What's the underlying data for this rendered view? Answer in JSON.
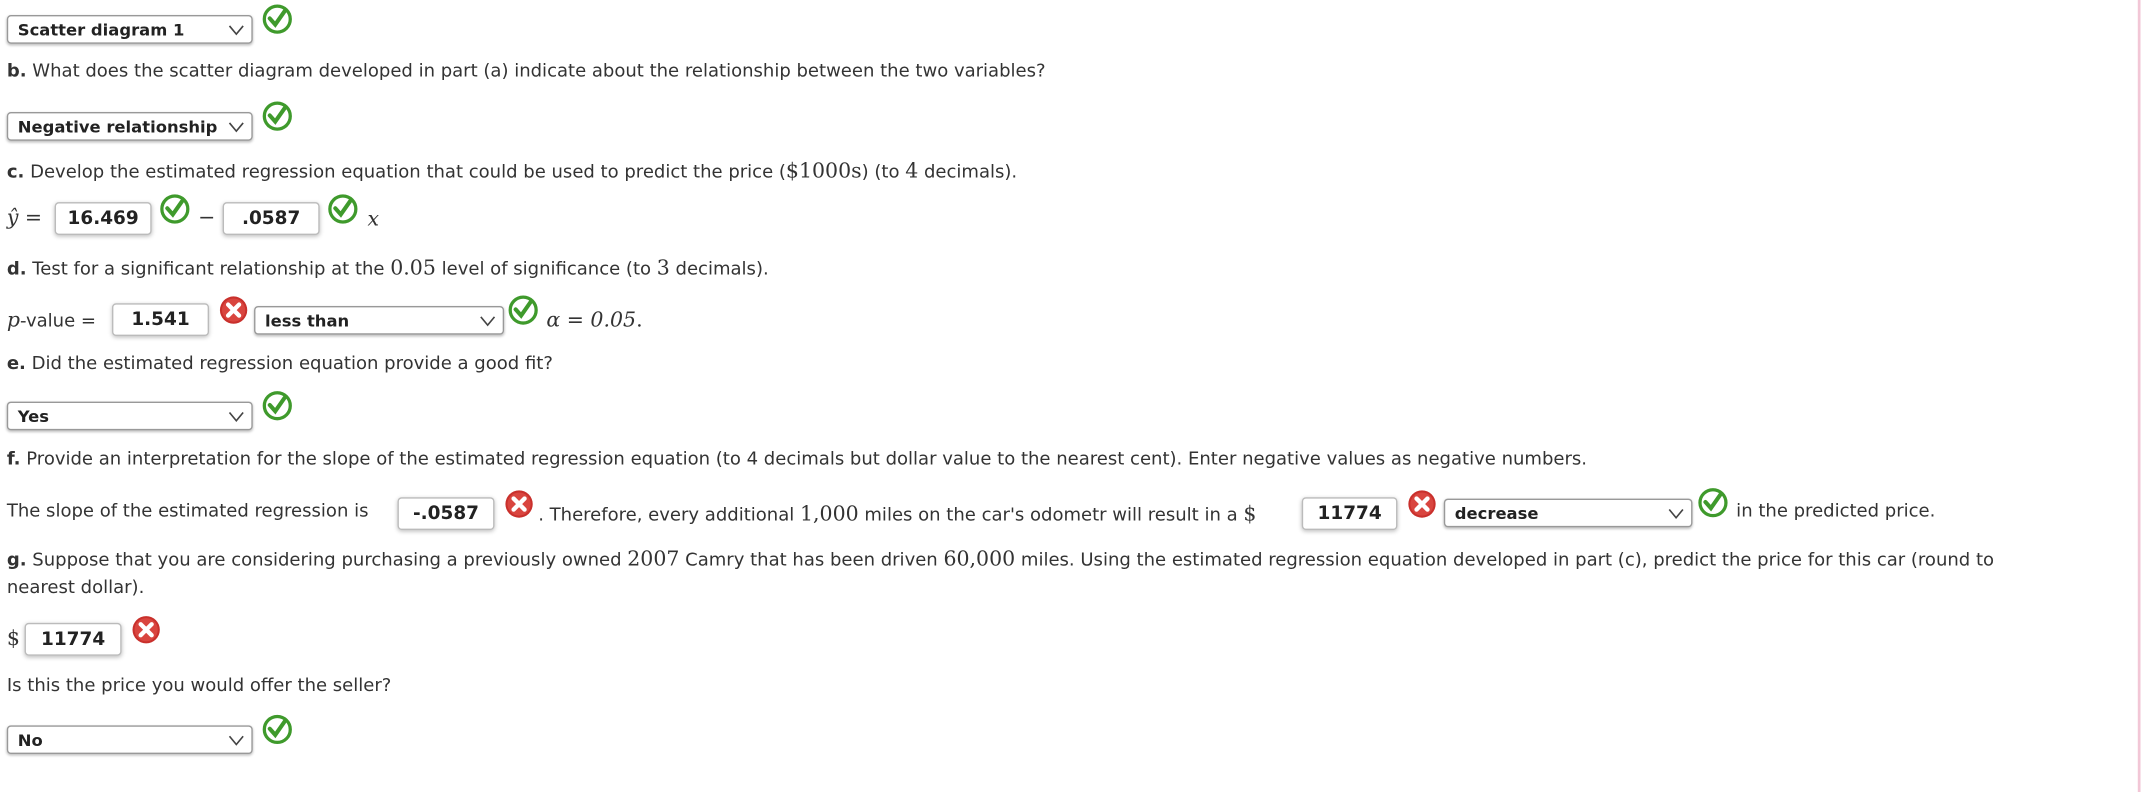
{
  "part_a": {
    "select_value": "Scatter diagram 1",
    "status": "correct"
  },
  "part_b": {
    "letter": "b.",
    "question": " What does the scatter diagram developed in part (a) indicate about the relationship between the two variables?",
    "select_value": "Negative relationship",
    "status": "correct"
  },
  "part_c": {
    "letter": "c.",
    "question_pre": " Develop the estimated regression equation that could be used to predict the price (",
    "question_math": "$1000s",
    "question_post": ") (to ",
    "decimals": "4",
    "question_end": " decimals).",
    "yhat": "ŷ =",
    "intercept": "16.469",
    "intercept_status": "correct",
    "minus": "−",
    "slope": ".0587",
    "slope_status": "correct",
    "x": "x"
  },
  "part_d": {
    "letter": "d.",
    "q1": " Test for a significant relationship at the ",
    "level": "0.05",
    "q2": " level of significance (to ",
    "decimals": "3",
    "q3": " decimals).",
    "p_label": "p",
    "p_label_rest": "-value =",
    "p_value": "1.541",
    "p_status": "incorrect",
    "comparison": "less than",
    "comparison_status": "correct",
    "alpha_text": "α = 0.05",
    "period": "."
  },
  "part_e": {
    "letter": "e.",
    "question": " Did the estimated regression equation provide a good fit?",
    "select_value": "Yes",
    "status": "correct"
  },
  "part_f": {
    "letter": "f.",
    "question": " Provide an interpretation for the slope of the estimated regression equation (to 4 decimals but dollar value to the nearest cent). Enter negative values as negative numbers.",
    "s1": "The slope of the estimated regression is",
    "slope": "-.0587",
    "slope_status": "incorrect",
    "s2": ". Therefore, every additional ",
    "miles": "1,000",
    "s3": " miles on the car's odometr will result in a ",
    "dollar": "$",
    "amount": "11774",
    "amount_status": "incorrect",
    "direction": "decrease",
    "direction_status": "correct",
    "s4": "in the predicted price."
  },
  "part_g": {
    "letter": "g.",
    "q1": " Suppose that you are considering purchasing a previously owned ",
    "year": "2007",
    "q2": " Camry that has been driven ",
    "miles": "60,000",
    "q3": " miles. Using the estimated regression equation developed in part (c), predict the price for this car (round to",
    "q4": "nearest dollar).",
    "dollar": "$",
    "price": "11774",
    "price_status": "incorrect",
    "offer_question": "Is this the price you would offer the seller?",
    "offer_value": "No",
    "offer_status": "correct"
  },
  "colors": {
    "correct": "#3f9a2c",
    "incorrect": "#c9302c",
    "text": "#333333"
  }
}
